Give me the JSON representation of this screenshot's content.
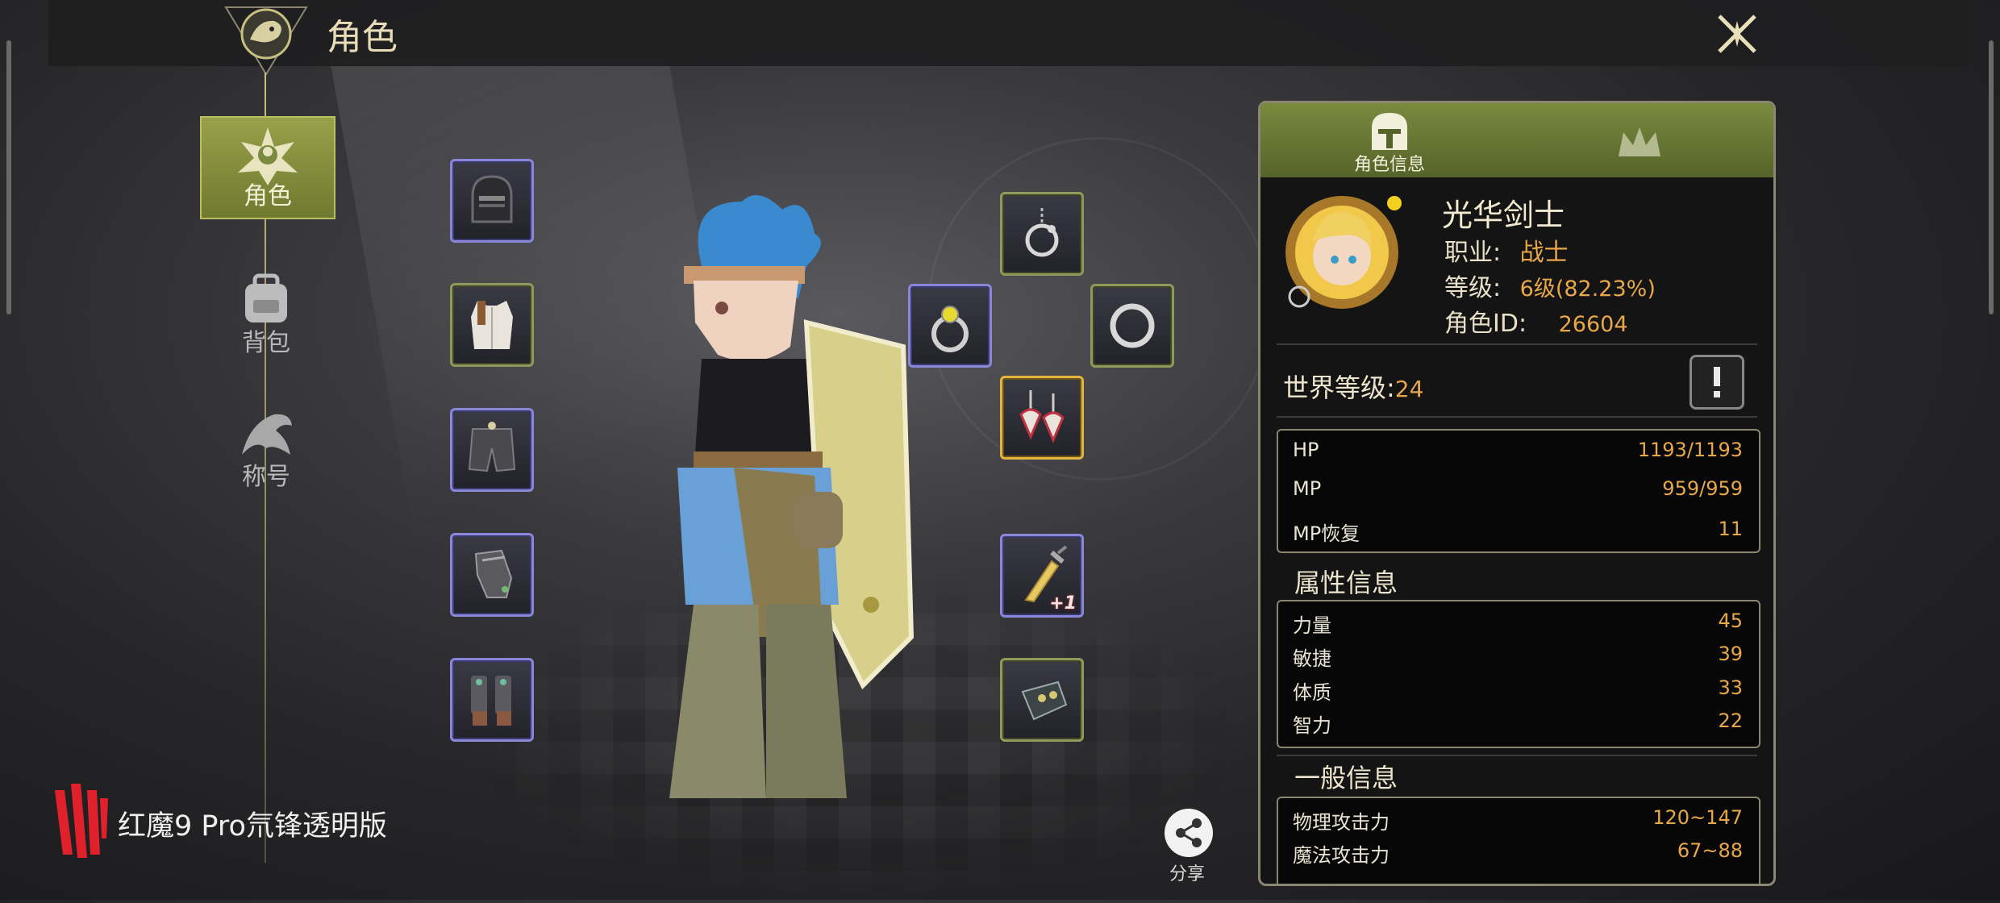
{
  "header": {
    "title": "角色"
  },
  "sidebar": {
    "items": [
      {
        "label": "角色",
        "active": true
      },
      {
        "label": "背包",
        "active": false
      },
      {
        "label": "称号",
        "active": false
      }
    ]
  },
  "equipment": {
    "left": [
      "helmet",
      "chest-armor",
      "pants",
      "gloves",
      "boots"
    ],
    "right": [
      "necklace",
      "ring-left",
      "ring-right",
      "earrings",
      "weapon",
      "glove-accessory"
    ],
    "weapon_enhance": "+1"
  },
  "share": {
    "label": "分享"
  },
  "branding": {
    "text": "红魔9 Pro氘锋透明版"
  },
  "panel": {
    "tabs": [
      {
        "label": "角色信息"
      },
      {
        "label": ""
      }
    ],
    "character": {
      "name": "光华剑士",
      "class_label": "职业:",
      "class_value": "战士",
      "level_label": "等级:",
      "level_value": "6级(82.23%)",
      "id_label": "角色ID:",
      "id_value": "26604"
    },
    "world_level_label": "世界等级:",
    "world_level_value": "24",
    "stats": [
      {
        "name": "HP",
        "value": "1193/1193"
      },
      {
        "name": "MP",
        "value": "959/959"
      },
      {
        "name": "MP恢复",
        "value": "11"
      }
    ],
    "attributes_title": "属性信息",
    "attributes": [
      {
        "name": "力量",
        "value": "45"
      },
      {
        "name": "敏捷",
        "value": "39"
      },
      {
        "name": "体质",
        "value": "33"
      },
      {
        "name": "智力",
        "value": "22"
      }
    ],
    "general_title": "一般信息",
    "general": [
      {
        "name": "物理攻击力",
        "value": "120~147"
      },
      {
        "name": "魔法攻击力",
        "value": "67~88"
      }
    ]
  },
  "colors": {
    "accent_green": "#7a8a3e",
    "value_orange": "#e8a84a",
    "slot_purple": "#8a86d8",
    "slot_gold": "#e2b63e"
  }
}
